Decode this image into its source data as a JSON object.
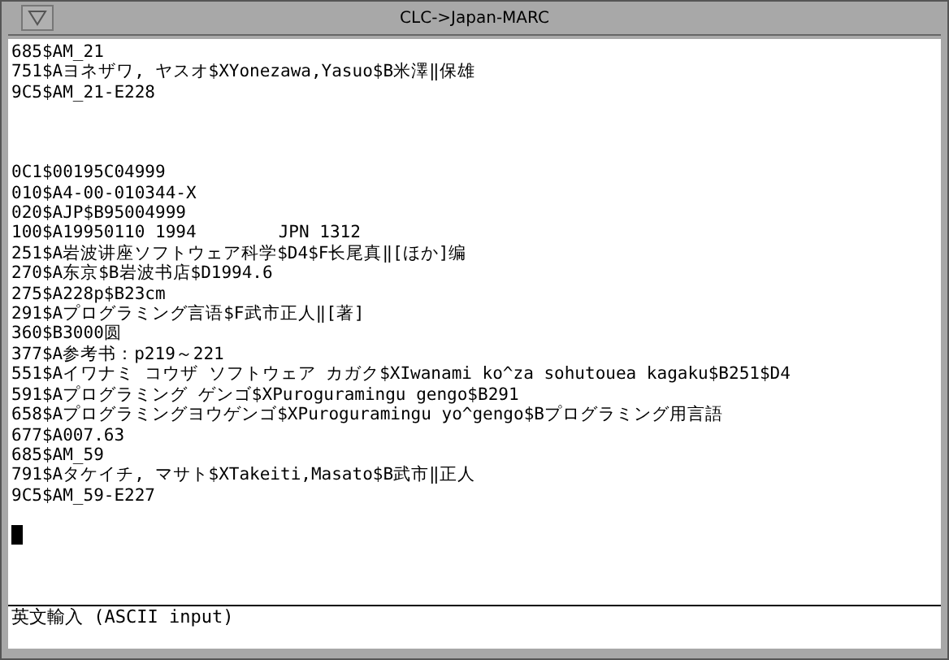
{
  "window": {
    "title": "CLC->Japan-MARC"
  },
  "records": [
    [
      "685$AM_21",
      "751$Aヨネザワ, ヤスオ$XYonezawa,Yasuo$B米澤‖保雄",
      "9C5$AM_21-E228"
    ],
    [
      "0C1$00195C04999",
      "010$A4-00-010344-X",
      "020$AJP$B95004999",
      "100$A19950110 1994        JPN 1312",
      "251$A岩波讲座ソフトウェア科学$D4$F长尾真‖[ほか]编",
      "270$A东京$B岩波书店$D1994.6",
      "275$A228p$B23cm",
      "291$Aプログラミング言语$F武市正人‖[著]",
      "360$B3000圆",
      "377$A参考书：p219～221",
      "551$Aイワナミ コウザ ソフトウェア カガク$XIwanami ko^za sohutouea kagaku$B251$D4",
      "591$Aプログラミング ゲンゴ$XPuroguramingu gengo$B291",
      "658$Aプログラミングヨウゲンゴ$XPuroguramingu yo^gengo$Bプログラミング用言語",
      "677$A007.63",
      "685$AM_59",
      "791$Aタケイチ, マサト$XTakeiti,Masato$B武市‖正人",
      "9C5$AM_59-E227"
    ]
  ],
  "status_bar": {
    "text": "英文輸入 (ASCII input)"
  }
}
